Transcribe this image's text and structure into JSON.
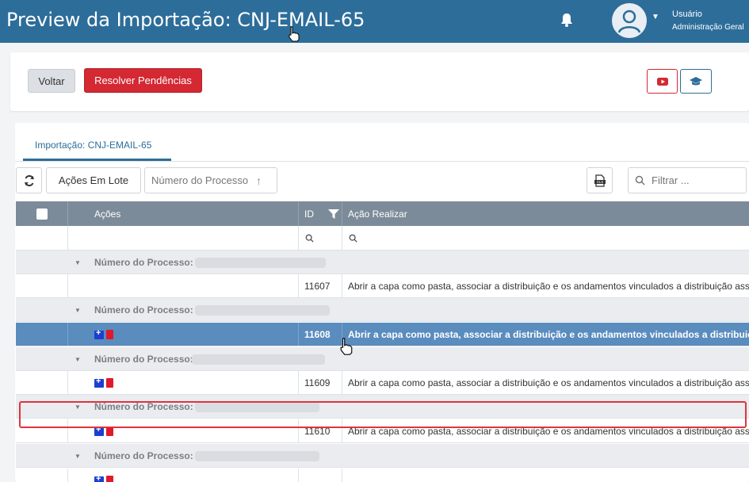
{
  "header": {
    "title": "Preview da Importação: CNJ-EMAIL-65",
    "user_name": "Usuário",
    "user_role": "Administração Geral"
  },
  "actions": {
    "voltar_label": "Voltar",
    "resolver_label": "Resolver Pendências"
  },
  "tabs": [
    {
      "label": "Importação: CNJ-EMAIL-65",
      "active": true
    }
  ],
  "toolbar": {
    "lote_label": "Ações Em Lote",
    "sort_label": "Número do Processo",
    "filter_placeholder": "Filtrar ..."
  },
  "grid": {
    "columns": [
      "Ações",
      "ID",
      "Ação Realizar"
    ],
    "group_label": "Número do Processo:",
    "rows": [
      {
        "id": "11607",
        "acao": "Abrir a capa como pasta, associar a distribuição e os andamentos vinculados a distribuição associada a essa capa",
        "selected": false,
        "has_icons": false
      },
      {
        "id": "11608",
        "acao": "Abrir a capa como pasta, associar a distribuição e os andamentos vinculados a distribuição associada a essa capa",
        "selected": true,
        "has_icons": true
      },
      {
        "id": "11609",
        "acao": "Abrir a capa como pasta, associar a distribuição e os andamentos vinculados a distribuição associada a essa capa",
        "selected": false,
        "has_icons": true
      },
      {
        "id": "11610",
        "acao": "Abrir a capa como pasta, associar a distribuição e os andamentos vinculados a distribuição associada a essa capa",
        "selected": false,
        "has_icons": true
      }
    ]
  },
  "colors": {
    "topbar": "#2d6d9a",
    "danger": "#d42833",
    "header_row": "#7c8b99",
    "selected_row": "#5a8cbe"
  }
}
